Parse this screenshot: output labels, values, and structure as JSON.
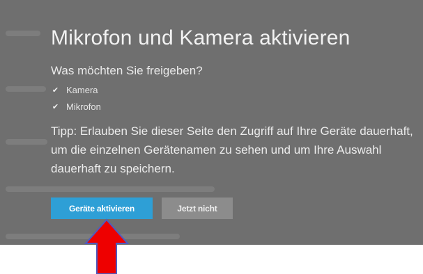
{
  "dialog": {
    "title": "Mikrofon und Kamera aktivieren",
    "question": "Was möchten Sie freigeben?",
    "options": [
      {
        "label": "Kamera",
        "checked": true
      },
      {
        "label": "Mikrofon",
        "checked": true
      }
    ],
    "tip": "Tipp: Erlauben Sie dieser Seite den Zugriff auf Ihre Geräte dauerhaft, um die einzelnen Gerätenamen zu sehen und um Ihre Auswahl dauerhaft zu speichern.",
    "buttons": {
      "activate_label": "Geräte aktivieren",
      "dismiss_label": "Jetzt nicht"
    }
  },
  "annotation": {
    "arrow_icon": "red-up-arrow-icon",
    "arrow_color": "#ee0000",
    "arrow_outline": "#4f5bbf"
  },
  "colors": {
    "overlay": "#6f6f6f",
    "primary_button": "#2e9fd6",
    "secondary_button": "#8c8c8c"
  }
}
